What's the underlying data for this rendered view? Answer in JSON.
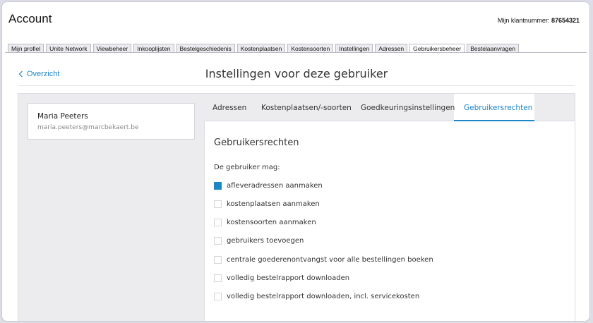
{
  "app": {
    "title": "Account",
    "customer_label": "Mijn klantnummer:",
    "customer_number": "87654321"
  },
  "tabs": [
    {
      "label": "Mijn profiel"
    },
    {
      "label": "Unite Network"
    },
    {
      "label": "Viewbeheer"
    },
    {
      "label": "Inkooplijsten"
    },
    {
      "label": "Bestelgeschiedenis"
    },
    {
      "label": "Kostenplaatsen"
    },
    {
      "label": "Kostensoorten"
    },
    {
      "label": "Instellingen"
    },
    {
      "label": "Adressen"
    },
    {
      "label": "Gebruikersbeheer",
      "active": true
    },
    {
      "label": "Bestelaanvragen"
    }
  ],
  "header": {
    "back_label": "Overzicht",
    "title": "Instellingen voor deze gebruiker"
  },
  "user": {
    "name": "Maria Peeters",
    "email": "maria.peeters@marcbekaert.be"
  },
  "subtabs": [
    {
      "label": "Adressen"
    },
    {
      "label": "Kostenplaatsen/-soorten"
    },
    {
      "label": "Goedkeuringsinstellingen"
    },
    {
      "label": "Gebruikersrechten",
      "active": true
    }
  ],
  "rights": {
    "title": "Gebruikersrechten",
    "intro": "De gebruiker mag:",
    "options": [
      {
        "label": "afleveradressen aanmaken",
        "checked": true
      },
      {
        "label": "kostenplaatsen aanmaken",
        "checked": false
      },
      {
        "label": "kostensoorten aanmaken",
        "checked": false
      },
      {
        "label": "gebruikers toevoegen",
        "checked": false
      },
      {
        "label": "centrale goederenontvangst voor alle bestellingen boeken",
        "checked": false
      },
      {
        "label": "volledig bestelrapport downloaden",
        "checked": false
      },
      {
        "label": "volledig bestelrapport downloaden, incl. servicekosten",
        "checked": false
      }
    ]
  },
  "colors": {
    "accent": "#1c86c7",
    "panel_bg": "#ececee"
  }
}
